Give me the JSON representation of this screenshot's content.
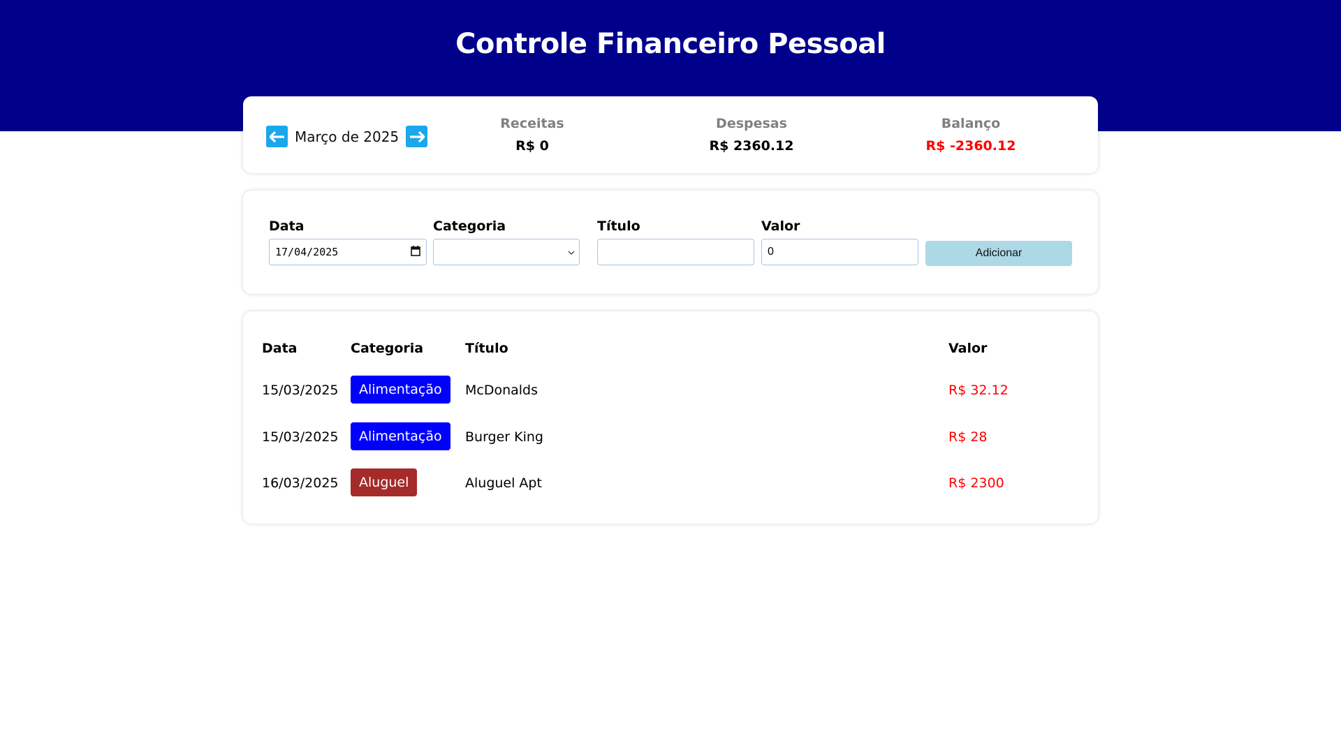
{
  "app": {
    "title": "Controle Financeiro Pessoal"
  },
  "colors": {
    "header_bg": "#00008b",
    "nav_arrow": "#1aa7ec",
    "negative": "#ff0000",
    "add_button_bg": "#add8e6"
  },
  "summary": {
    "month": "Março de 2025",
    "prev_icon": "arrow-left-icon",
    "next_icon": "arrow-right-icon",
    "receitas_label": "Receitas",
    "receitas_value": "R$ 0",
    "despesas_label": "Despesas",
    "despesas_value": "R$ 2360.12",
    "balanco_label": "Balanço",
    "balanco_value": "R$ -2360.12"
  },
  "form": {
    "data_label": "Data",
    "data_value": "17/04/2025",
    "categoria_label": "Categoria",
    "categoria_value": "",
    "titulo_label": "Título",
    "titulo_value": "",
    "valor_label": "Valor",
    "valor_value": "0",
    "add_label": "Adicionar"
  },
  "table": {
    "headers": {
      "date": "Data",
      "category": "Categoria",
      "title": "Título",
      "value": "Valor"
    },
    "rows": [
      {
        "date": "15/03/2025",
        "category": "Alimentação",
        "category_color": "#0000ff",
        "title": "McDonalds",
        "value": "R$ 32.12"
      },
      {
        "date": "15/03/2025",
        "category": "Alimentação",
        "category_color": "#0000ff",
        "title": "Burger King",
        "value": "R$ 28"
      },
      {
        "date": "16/03/2025",
        "category": "Aluguel",
        "category_color": "#a52a2a",
        "title": "Aluguel Apt",
        "value": "R$ 2300"
      }
    ]
  }
}
